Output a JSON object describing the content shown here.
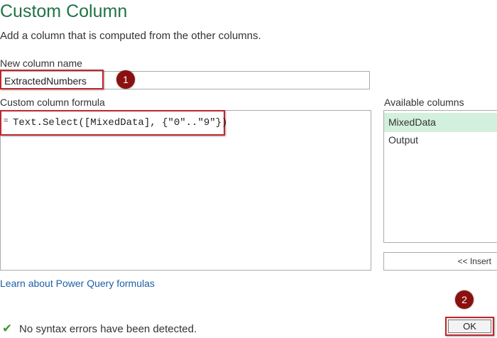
{
  "dialog": {
    "title": "Custom Column",
    "subtitle": "Add a column that is computed from the other columns."
  },
  "new_column": {
    "label": "New column name",
    "value": "ExtractedNumbers"
  },
  "formula": {
    "label": "Custom column formula",
    "prefix": "=",
    "value": "Text.Select([MixedData], {\"0\"..\"9\"})"
  },
  "available_columns": {
    "label": "Available columns",
    "items": [
      "MixedData",
      "Output"
    ],
    "selected": "MixedData",
    "insert_label": "<< Insert"
  },
  "learn_link": "Learn about Power Query formulas",
  "status": {
    "icon": "checkmark-icon",
    "text": "No syntax errors have been detected."
  },
  "ok_label": "OK",
  "annotations": {
    "badge1": "1",
    "badge2": "2"
  },
  "colors": {
    "title": "#217346",
    "highlight": "#c0262c",
    "badge": "#8b1010",
    "selected_item": "#d2f0db",
    "link": "#1e5ea8"
  }
}
